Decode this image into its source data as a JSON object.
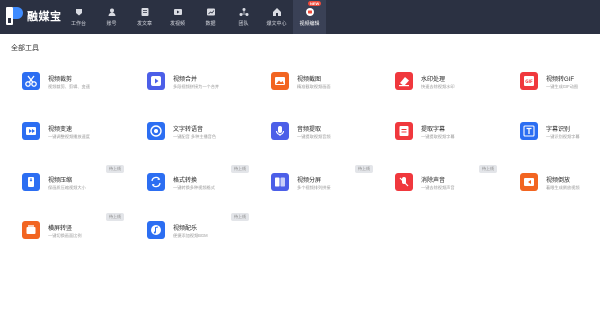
{
  "app": {
    "name": "融媒宝"
  },
  "nav": [
    {
      "label": "工作台",
      "icon": "workbench-icon"
    },
    {
      "label": "账号",
      "icon": "account-icon"
    },
    {
      "label": "发文章",
      "icon": "article-icon"
    },
    {
      "label": "发视频",
      "icon": "video-publish-icon"
    },
    {
      "label": "数据",
      "icon": "data-icon"
    },
    {
      "label": "团队",
      "icon": "team-icon"
    },
    {
      "label": "爆文中心",
      "icon": "hot-article-icon"
    },
    {
      "label": "视频编辑",
      "icon": "video-edit-icon",
      "badge": "NEW",
      "active": true
    }
  ],
  "section_title": "全部工具",
  "tools": [
    {
      "name": "视频裁剪",
      "desc": "视频裁剪、剪辑、变速",
      "icon": "scissors-icon",
      "color": "blue",
      "tag": ""
    },
    {
      "name": "视频合并",
      "desc": "多段视频拼接为一个合并",
      "icon": "merge-play-icon",
      "color": "indigo",
      "tag": ""
    },
    {
      "name": "视频截图",
      "desc": "精准截取视频画面",
      "icon": "image-icon",
      "color": "orange",
      "tag": ""
    },
    {
      "name": "水印处理",
      "desc": "快速去除视频水印",
      "icon": "eraser-icon",
      "color": "red",
      "tag": ""
    },
    {
      "name": "视频转GIF",
      "desc": "一键生成GIF动图",
      "icon": "gif-icon",
      "color": "red",
      "tag": ""
    },
    {
      "name": "视频变速",
      "desc": "一键调整视频播放速度",
      "icon": "speed-icon",
      "color": "blue",
      "tag": ""
    },
    {
      "name": "文字转语音",
      "desc": "一键配音 多种主播音色",
      "icon": "tts-icon",
      "color": "blue",
      "tag": ""
    },
    {
      "name": "音频提取",
      "desc": "一键提取视频音频",
      "icon": "audio-icon",
      "color": "indigo",
      "tag": ""
    },
    {
      "name": "提取字幕",
      "desc": "一键提取视频字幕",
      "icon": "subtitle-icon",
      "color": "red",
      "tag": ""
    },
    {
      "name": "字幕识别",
      "desc": "一键识别视频字幕",
      "icon": "text-recognize-icon",
      "color": "blue",
      "tag": ""
    },
    {
      "name": "视频压缩",
      "desc": "保画质压缩视频大小",
      "icon": "compress-icon",
      "color": "blue",
      "tag": "待上线"
    },
    {
      "name": "格式转换",
      "desc": "一键转换多种视频格式",
      "icon": "convert-icon",
      "color": "blue",
      "tag": "待上线"
    },
    {
      "name": "视频分屏",
      "desc": "多个视频排列拼接",
      "icon": "split-screen-icon",
      "color": "indigo",
      "tag": "待上线"
    },
    {
      "name": "消除声音",
      "desc": "一键去除视频声音",
      "icon": "mute-icon",
      "color": "red",
      "tag": "待上线"
    },
    {
      "name": "视频倒放",
      "desc": "着眼生成倒放视频",
      "icon": "reverse-icon",
      "color": "orange",
      "tag": "待上线"
    },
    {
      "name": "横屏转竖",
      "desc": "一键切换画面比例",
      "icon": "rotate-icon",
      "color": "orange",
      "tag": "待上线"
    },
    {
      "name": "视频配乐",
      "desc": "便捷添加视频BGM",
      "icon": "music-icon",
      "color": "blue",
      "tag": "待上线"
    }
  ]
}
